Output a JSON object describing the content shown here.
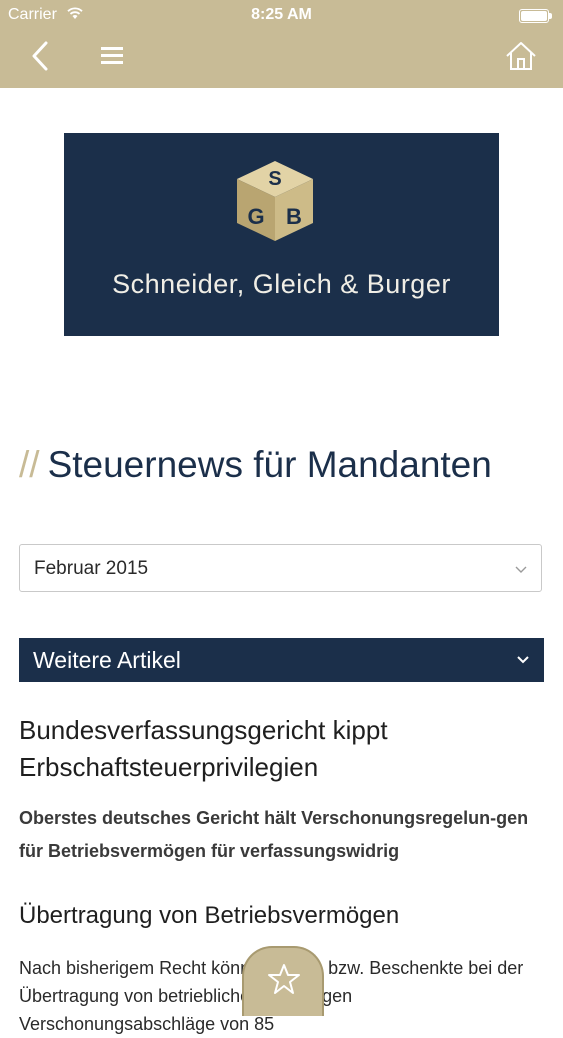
{
  "status_bar": {
    "carrier": "Carrier",
    "time": "8:25 AM"
  },
  "nav": {
    "back_icon": "back-chevron-icon",
    "menu_icon": "hamburger-menu-icon",
    "home_icon": "home-icon"
  },
  "logo": {
    "cube_letters": "SGB",
    "firm_name": "Schneider, Gleich & Burger"
  },
  "page": {
    "title_prefix": "//",
    "title": "Steuernews für Mandanten"
  },
  "month_select": {
    "selected": "Februar 2015"
  },
  "accordion": {
    "label": "Weitere Artikel"
  },
  "article": {
    "headline": "Bundesverfassungsgericht kippt Erbschaftsteuerprivilegien",
    "subheadline": "Oberstes deutsches Gericht hält Verschonungsregelun-gen für Betriebsvermögen für verfassungswidrig",
    "section_title": "Übertragung von Betriebsvermögen",
    "body": "Nach bisherigem Recht können Erben bzw. Beschenkte bei der Übertragung von betrieblichem Vermögen Verschonungsabschläge von 85"
  },
  "colors": {
    "bar": "#c8bb96",
    "navy": "#1b2f4a"
  }
}
